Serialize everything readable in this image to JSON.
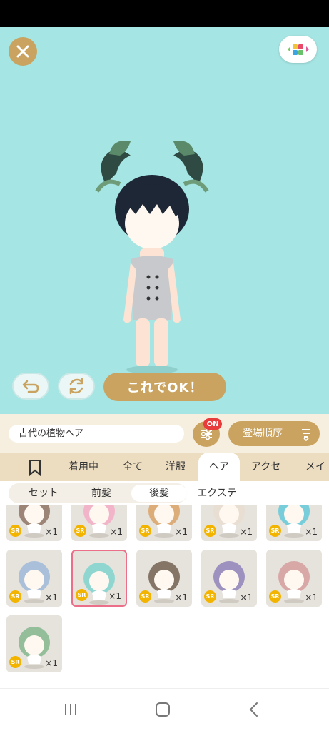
{
  "preview": {
    "ok_label": "これでOK！"
  },
  "item_bar": {
    "current_item_name": "古代の植物ヘア",
    "filter_badge": "ON",
    "sort_label": "登場順序"
  },
  "tabs": [
    {
      "label": "着用中"
    },
    {
      "label": "全て"
    },
    {
      "label": "洋服"
    },
    {
      "label": "ヘア",
      "active": true
    },
    {
      "label": "アクセ"
    },
    {
      "label": "メイク"
    }
  ],
  "subtabs": [
    {
      "label": "セット"
    },
    {
      "label": "前髪"
    },
    {
      "label": "後髪",
      "active": true
    },
    {
      "label": "エクステ"
    }
  ],
  "items": [
    {
      "rarity": "SR",
      "qty": "×1",
      "hair": "#8a6e5c"
    },
    {
      "rarity": "SR",
      "qty": "×1",
      "hair": "#f5a9c3"
    },
    {
      "rarity": "SR",
      "qty": "×1",
      "hair": "#d9a060"
    },
    {
      "rarity": "SR",
      "qty": "×1",
      "hair": "#e8ddd0"
    },
    {
      "rarity": "SR",
      "qty": "×1",
      "hair": "#5bc8d8"
    },
    {
      "rarity": "SR",
      "qty": "×1",
      "hair": "#9bb6d8"
    },
    {
      "rarity": "SR",
      "qty": "×1",
      "hair": "#7ad3cd",
      "selected": true
    },
    {
      "rarity": "SR",
      "qty": "×1",
      "hair": "#6b5a48"
    },
    {
      "rarity": "SR",
      "qty": "×1",
      "hair": "#8b7db8"
    },
    {
      "rarity": "SR",
      "qty": "×1",
      "hair": "#d49a9a"
    },
    {
      "rarity": "SR",
      "qty": "×1",
      "hair": "#7fb58a"
    }
  ],
  "colors": {
    "accent_gold": "#c9a35f",
    "background_teal": "#a5e5e3",
    "badge_red": "#e83b3b",
    "selected_border": "#ec6f8a"
  }
}
